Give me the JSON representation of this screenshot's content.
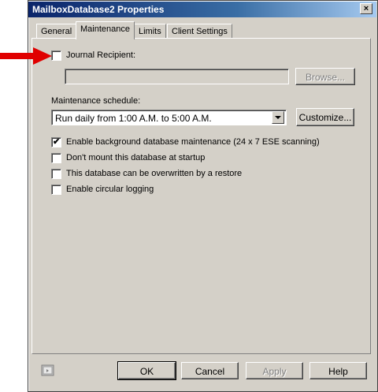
{
  "window": {
    "title": "MailboxDatabase2 Properties",
    "close_glyph": "×"
  },
  "tabs": [
    {
      "label": "General",
      "active": false
    },
    {
      "label": "Maintenance",
      "active": true
    },
    {
      "label": "Limits",
      "active": false
    },
    {
      "label": "Client Settings",
      "active": false
    }
  ],
  "journal": {
    "label": "Journal Recipient:",
    "checked": false,
    "value": "",
    "browse_label": "Browse..."
  },
  "maintenance": {
    "schedule_label": "Maintenance schedule:",
    "schedule_value": "Run daily from 1:00 A.M. to 5:00 A.M.",
    "customize_label": "Customize..."
  },
  "options": [
    {
      "label": "Enable background database maintenance (24 x 7 ESE scanning)",
      "checked": true
    },
    {
      "label": "Don't mount this database at startup",
      "checked": false
    },
    {
      "label": "This database can be overwritten by a restore",
      "checked": false
    },
    {
      "label": "Enable circular logging",
      "checked": false
    }
  ],
  "footer": {
    "ok": "OK",
    "cancel": "Cancel",
    "apply": "Apply",
    "help": "Help"
  },
  "colors": {
    "annotation_arrow": "#e00000",
    "title_bar": "#0a246a",
    "dialog_face": "#d4d0c8"
  },
  "check_glyph": "✔"
}
